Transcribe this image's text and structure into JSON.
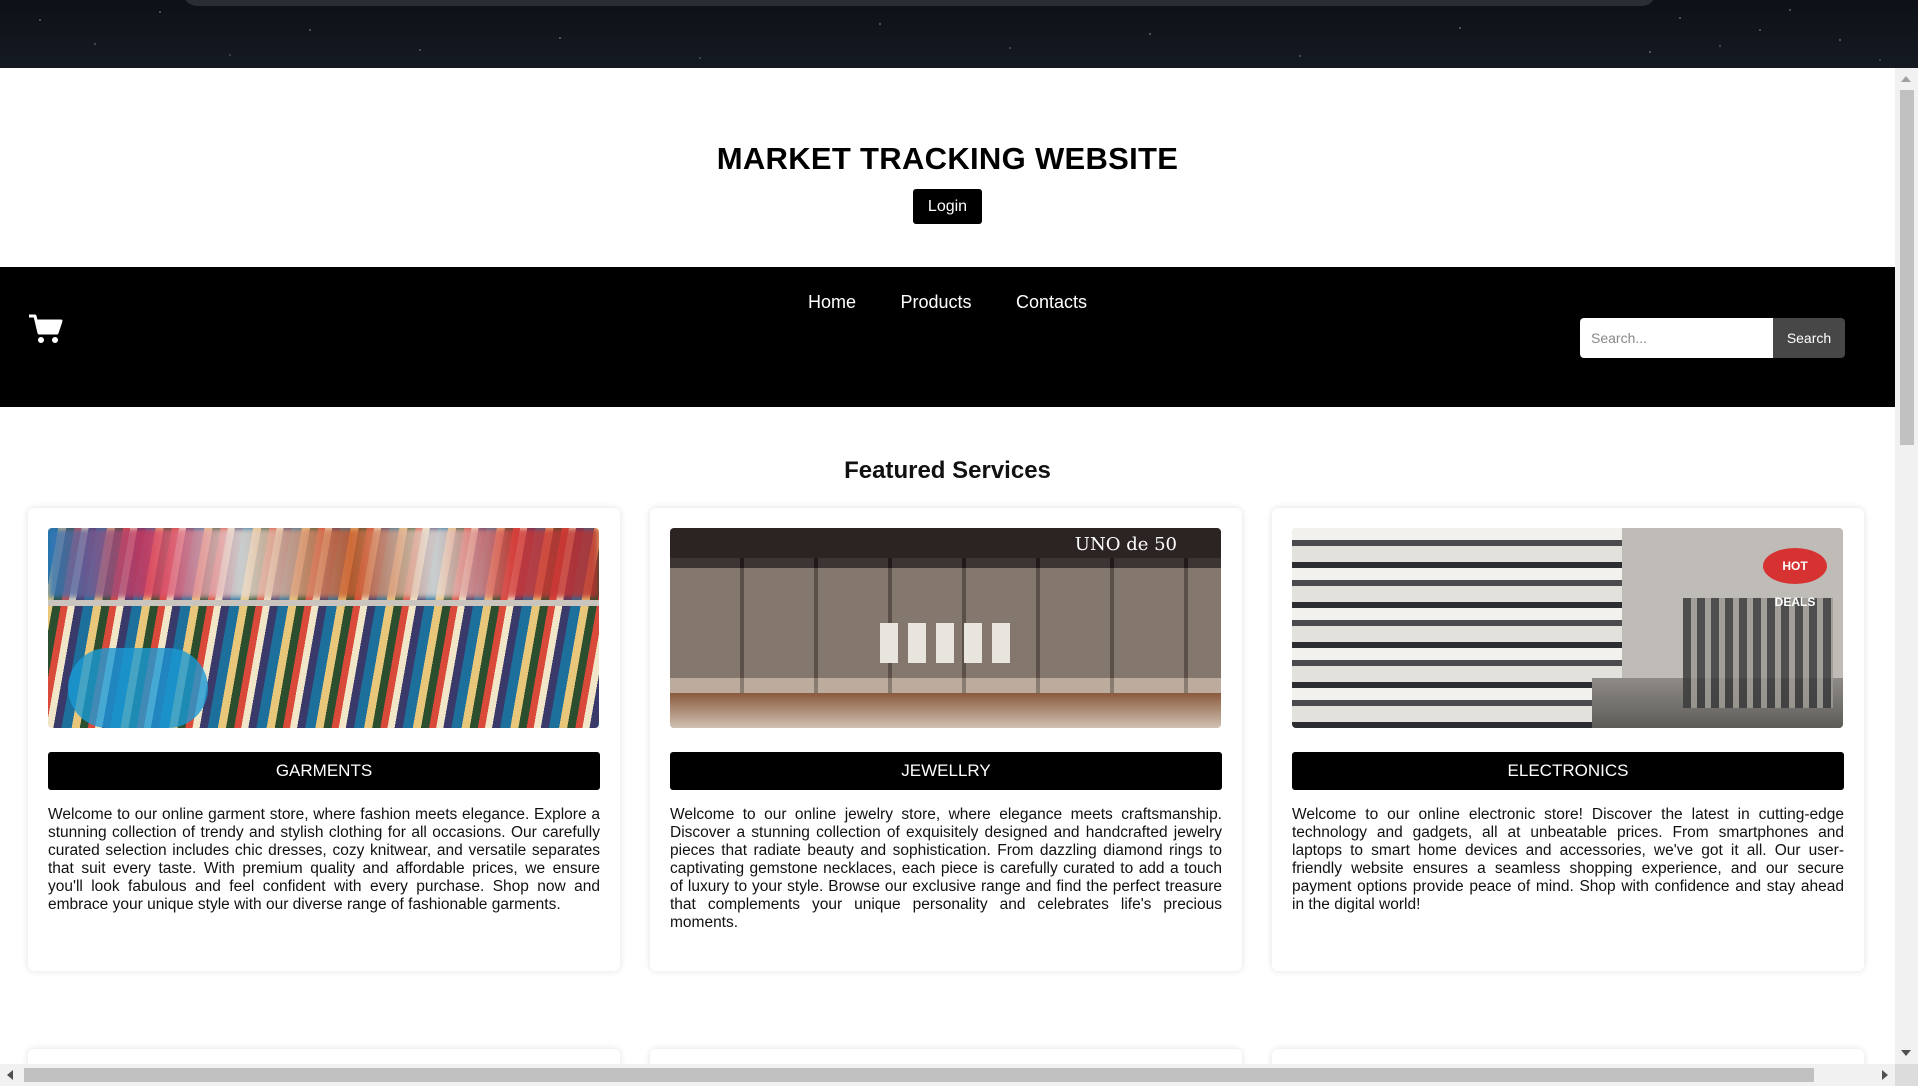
{
  "header": {
    "title": "MARKET TRACKING WEBSITE",
    "login_label": "Login"
  },
  "navbar": {
    "cart_icon": "shopping-cart-icon",
    "links": [
      {
        "label": "Home"
      },
      {
        "label": "Products"
      },
      {
        "label": "Contacts"
      }
    ],
    "search": {
      "placeholder": "Search...",
      "value": "",
      "button_label": "Search"
    }
  },
  "featured": {
    "title": "Featured Services",
    "cards": [
      {
        "label": "GARMENTS",
        "text": "Welcome to our online garment store, where fashion meets elegance. Explore a stunning collection of trendy and stylish clothing for all occasions. Our carefully curated selection includes chic dresses, cozy knitwear, and versatile separates that suit every taste. With premium quality and affordable prices, we ensure you'll look fabulous and feel confident with every purchase. Shop now and embrace your unique style with our diverse range of fashionable garments."
      },
      {
        "label": "JEWELLRY",
        "image_logo": "UNO de 50",
        "text": "Welcome to our online jewelry store, where elegance meets craftsmanship. Discover a stunning collection of exquisitely designed and handcrafted jewelry pieces that radiate beauty and sophistication. From dazzling diamond rings to captivating gemstone necklaces, each piece is carefully curated to add a touch of luxury to your style. Browse our exclusive range and find the perfect treasure that complements your unique personality and celebrates life's precious moments."
      },
      {
        "label": "ELECTRONICS",
        "image_sign": "HOT DEALS",
        "text": "Welcome to our online electronic store! Discover the latest in cutting-edge technology and gadgets, all at unbeatable prices. From smartphones and laptops to smart home devices and accessories, we've got it all. Our user-friendly website ensures a seamless shopping experience, and our secure payment options provide peace of mind. Shop with confidence and stay ahead in the digital world!"
      }
    ]
  },
  "colors": {
    "nav_bg": "#000000",
    "button_bg": "#000000",
    "search_button_bg": "#474747",
    "page_bg": "#ffffff"
  }
}
